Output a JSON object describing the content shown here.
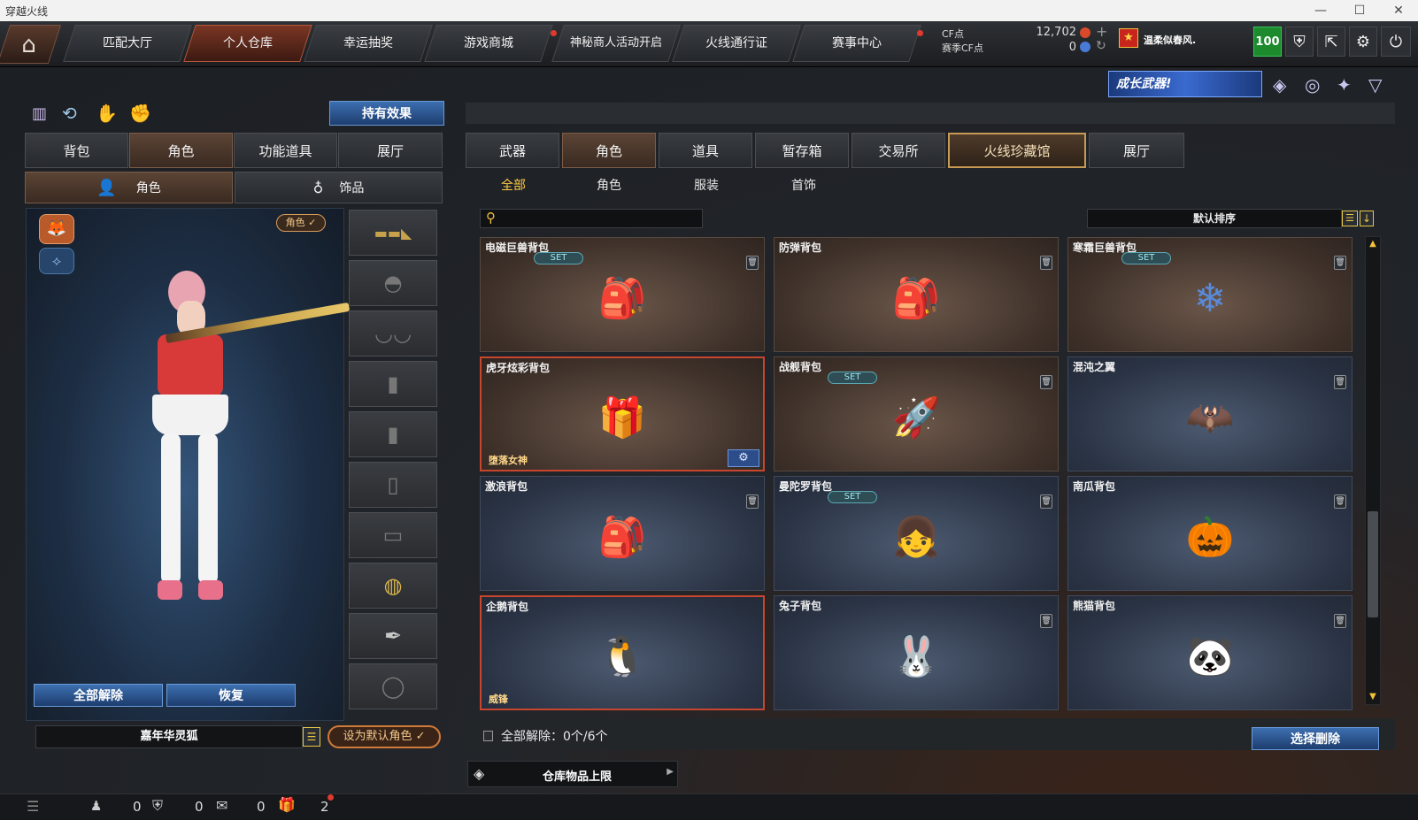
{
  "window": {
    "title": "穿越火线",
    "minimize": "—",
    "maximize": "☐",
    "close": "✕"
  },
  "topnav": {
    "home_icon": "home-icon",
    "tabs": [
      {
        "label": "匹配大厅"
      },
      {
        "label": "个人仓库"
      },
      {
        "label": "幸运抽奖"
      },
      {
        "label": "游戏商城"
      },
      {
        "label": "神秘商人活动开启"
      },
      {
        "label": "火线通行证"
      },
      {
        "label": "赛事中心"
      }
    ],
    "cf_label": "CF点",
    "cf_value": "12,702",
    "season_cf_label": "赛季CF点",
    "season_cf_value": "0",
    "player_name": "温柔似春风.",
    "level": "100"
  },
  "banner": {
    "text": "成长武器!"
  },
  "left": {
    "hold_effect_button": "持有效果",
    "tabs": [
      "背包",
      "角色",
      "功能道具",
      "展厅"
    ],
    "subtabs": [
      "角色",
      "饰品"
    ],
    "role_badge": "角色 ✓",
    "release_all": "全部解除",
    "restore": "恢复",
    "character_name": "嘉年华灵狐",
    "set_default": "设为默认角色 ✓"
  },
  "right": {
    "tabs": [
      "武器",
      "角色",
      "道具",
      "暂存箱",
      "交易所",
      "火线珍藏馆",
      "展厅"
    ],
    "subtabs": [
      "全部",
      "角色",
      "服装",
      "首饰"
    ],
    "search_placeholder": "",
    "sort_label": "默认排序",
    "items": [
      {
        "name": "电磁巨兽背包",
        "set": "SET",
        "art": "🎒"
      },
      {
        "name": "防弹背包",
        "set": "",
        "art": "🎒"
      },
      {
        "name": "寒霜巨兽背包",
        "set": "SET",
        "art": "❄"
      },
      {
        "name": "虎牙炫彩背包",
        "set": "",
        "art": "🎁",
        "tag": "堕落女神"
      },
      {
        "name": "战舰背包",
        "set": "SET",
        "art": "🚀"
      },
      {
        "name": "混沌之翼",
        "set": "",
        "art": "🦇"
      },
      {
        "name": "激浪背包",
        "set": "",
        "art": "🎒"
      },
      {
        "name": "曼陀罗背包",
        "set": "SET",
        "art": "👧"
      },
      {
        "name": "南瓜背包",
        "set": "",
        "art": "🎃"
      },
      {
        "name": "企鹅背包",
        "set": "",
        "art": "🐧",
        "tag": "威锋"
      },
      {
        "name": "兔子背包",
        "set": "",
        "art": "🐰"
      },
      {
        "name": "熊猫背包",
        "set": "",
        "art": "🐼"
      }
    ],
    "release_all_status": "全部解除：0个/6个",
    "select_delete": "选择删除",
    "storage_limit": "仓库物品上限"
  },
  "bottombar": {
    "count1": "0",
    "count2": "0",
    "count3": "0",
    "count4": "2"
  }
}
